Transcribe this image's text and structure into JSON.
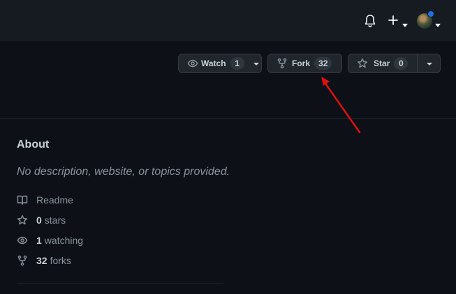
{
  "header": {
    "icons": [
      "bell-icon",
      "plus-icon",
      "avatar"
    ],
    "notification_color": "#1f6feb"
  },
  "repo_actions": {
    "watch_label": "Watch",
    "watch_count": "1",
    "fork_label": "Fork",
    "fork_count": "32",
    "star_label": "Star",
    "star_count": "0"
  },
  "about": {
    "title": "About",
    "description": "No description, website, or topics provided.",
    "readme_label": "Readme",
    "stars_count": "0",
    "stars_label": "stars",
    "watching_count": "1",
    "watching_label": "watching",
    "forks_count": "32",
    "forks_label": "forks"
  },
  "annotation": {
    "arrow_color": "#ff0000"
  }
}
